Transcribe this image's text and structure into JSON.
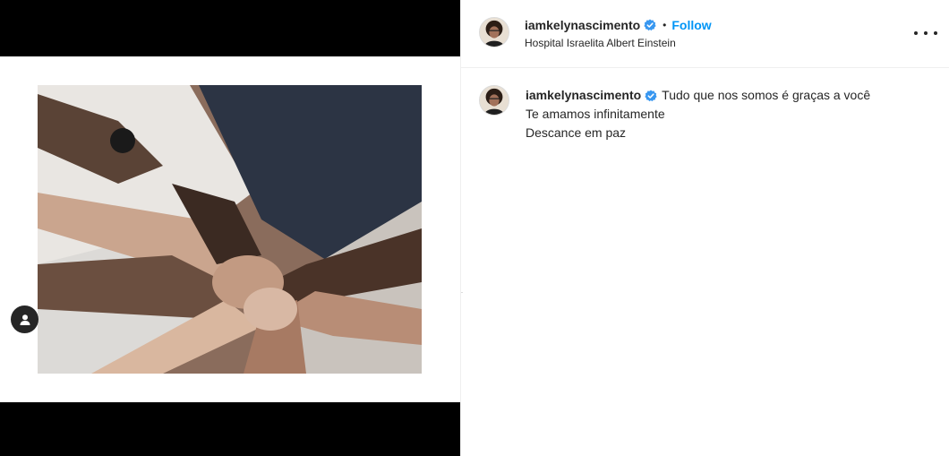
{
  "post": {
    "media": {
      "description_icon": "hands-photo",
      "tag_button_icon": "user-icon"
    },
    "header": {
      "username": "iamkelynascimento",
      "verified_icon": "verified-badge-icon",
      "separator": "•",
      "follow_label": "Follow",
      "location": "Hospital Israelita Albert Einstein",
      "more_icon": "more-options-icon"
    },
    "caption": {
      "username": "iamkelynascimento",
      "lines": [
        "Tudo que nos somos é graças a você",
        "Te amamos infinitamente",
        "Descance em paz"
      ]
    }
  },
  "colors": {
    "accent": "#0095f6",
    "verified": "#3897f0",
    "text": "#262626",
    "media_bg": "#000000"
  }
}
